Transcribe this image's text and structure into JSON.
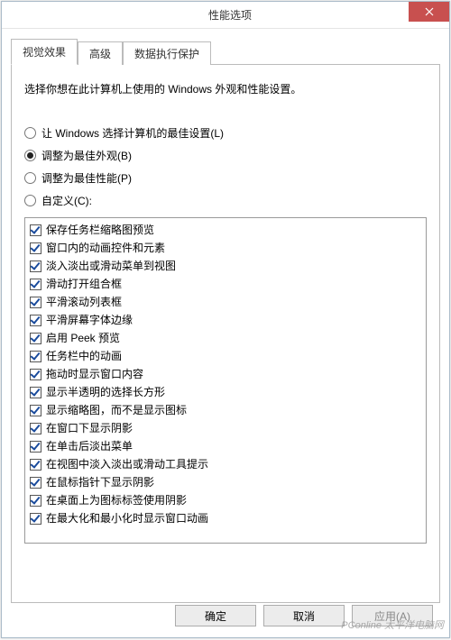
{
  "title": "性能选项",
  "tabs": [
    {
      "label": "视觉效果",
      "active": true
    },
    {
      "label": "高级",
      "active": false
    },
    {
      "label": "数据执行保护",
      "active": false
    }
  ],
  "description": "选择你想在此计算机上使用的 Windows 外观和性能设置。",
  "radios": [
    {
      "label": "让 Windows 选择计算机的最佳设置(L)",
      "selected": false
    },
    {
      "label": "调整为最佳外观(B)",
      "selected": true
    },
    {
      "label": "调整为最佳性能(P)",
      "selected": false
    },
    {
      "label": "自定义(C):",
      "selected": false
    }
  ],
  "checkItems": [
    {
      "label": "保存任务栏缩略图预览",
      "checked": true
    },
    {
      "label": "窗口内的动画控件和元素",
      "checked": true
    },
    {
      "label": "淡入淡出或滑动菜单到视图",
      "checked": true
    },
    {
      "label": "滑动打开组合框",
      "checked": true
    },
    {
      "label": "平滑滚动列表框",
      "checked": true
    },
    {
      "label": "平滑屏幕字体边缘",
      "checked": true
    },
    {
      "label": "启用 Peek 预览",
      "checked": true
    },
    {
      "label": "任务栏中的动画",
      "checked": true
    },
    {
      "label": "拖动时显示窗口内容",
      "checked": true
    },
    {
      "label": "显示半透明的选择长方形",
      "checked": true
    },
    {
      "label": "显示缩略图，而不是显示图标",
      "checked": true
    },
    {
      "label": "在窗口下显示阴影",
      "checked": true
    },
    {
      "label": "在单击后淡出菜单",
      "checked": true
    },
    {
      "label": "在视图中淡入淡出或滑动工具提示",
      "checked": true
    },
    {
      "label": "在鼠标指针下显示阴影",
      "checked": true
    },
    {
      "label": "在桌面上为图标标签使用阴影",
      "checked": true
    },
    {
      "label": "在最大化和最小化时显示窗口动画",
      "checked": true
    }
  ],
  "buttons": {
    "ok": "确定",
    "cancel": "取消",
    "apply": "应用(A)"
  },
  "watermark": "PConline 太平洋电脑网"
}
